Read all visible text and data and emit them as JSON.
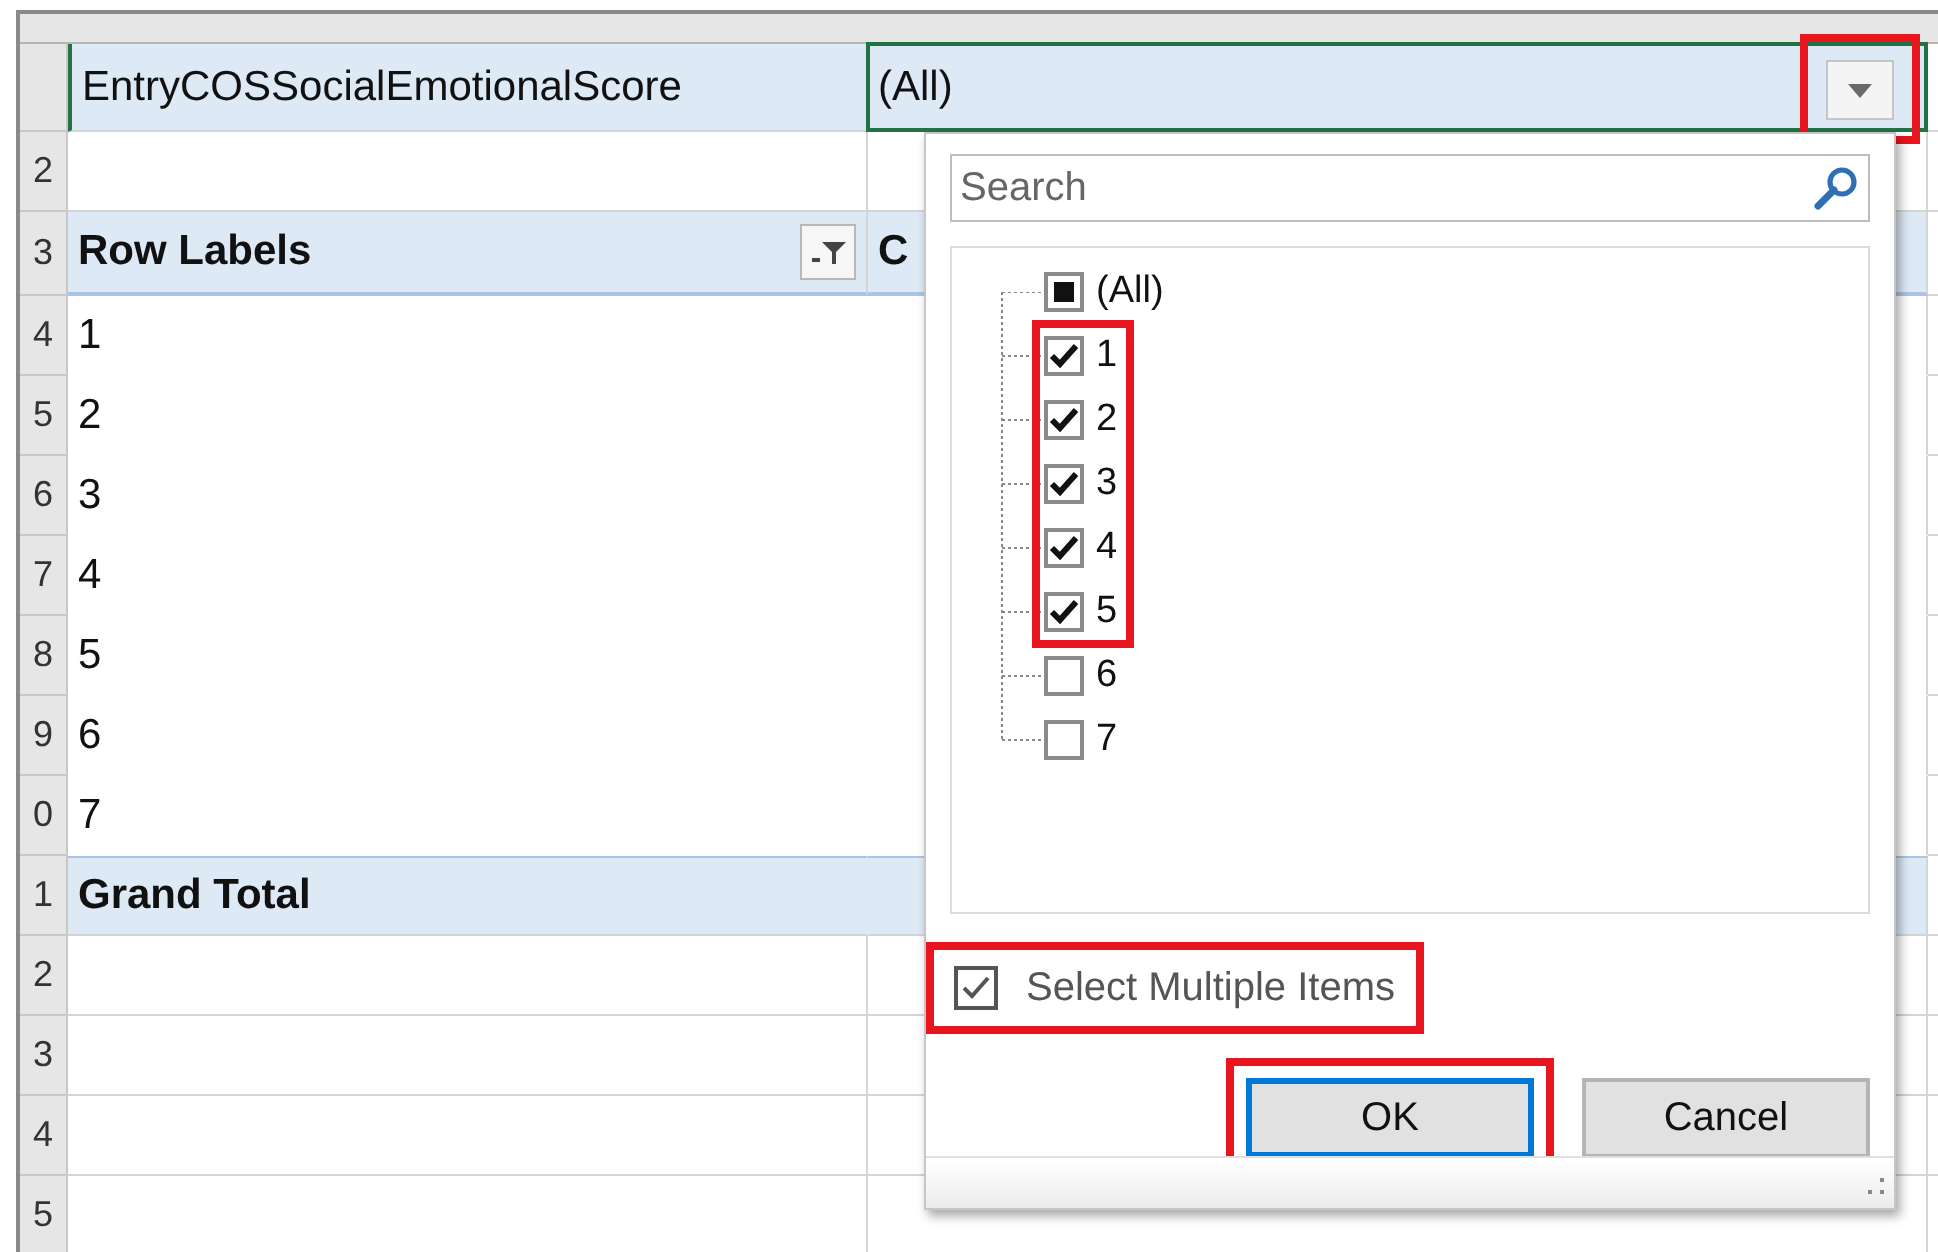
{
  "row_numbers": [
    "2",
    "3",
    "4",
    "5",
    "6",
    "7",
    "8",
    "9",
    "0",
    "1",
    "2",
    "3",
    "4",
    "5"
  ],
  "pivot": {
    "filter_field": {
      "label": "EntryCOSSocialEmotionalScore",
      "value": "(All)",
      "dropdown_highlighted": true
    },
    "header": {
      "row_labels": "Row Labels",
      "column_2": "C"
    },
    "rows": [
      "1",
      "2",
      "3",
      "4",
      "5",
      "6",
      "7"
    ],
    "grand_total": "Grand Total"
  },
  "filter_panel": {
    "search": {
      "placeholder": "Search"
    },
    "items": [
      {
        "label": "(All)",
        "checked": false,
        "indeterminate": true,
        "highlighted": false
      },
      {
        "label": "1",
        "checked": true,
        "highlighted": true
      },
      {
        "label": "2",
        "checked": true,
        "highlighted": true
      },
      {
        "label": "3",
        "checked": true,
        "highlighted": true
      },
      {
        "label": "4",
        "checked": true,
        "highlighted": true
      },
      {
        "label": "5",
        "checked": true,
        "highlighted": true
      },
      {
        "label": "6",
        "checked": false,
        "highlighted": false
      },
      {
        "label": "7",
        "checked": false,
        "highlighted": false
      }
    ],
    "select_multiple": {
      "label": "Select Multiple Items",
      "checked": true,
      "highlighted": true
    },
    "buttons": [
      {
        "label": "OK",
        "default": true,
        "highlighted": true
      },
      {
        "label": "Cancel",
        "default": false,
        "highlighted": false
      }
    ]
  }
}
